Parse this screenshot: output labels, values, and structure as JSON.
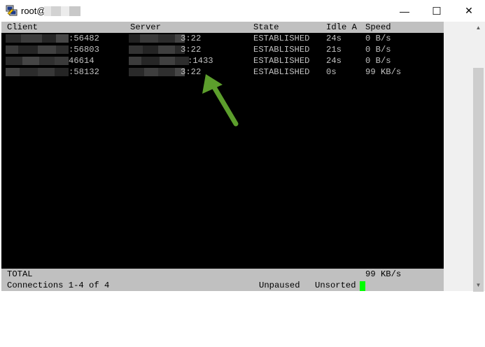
{
  "window": {
    "title": "root@",
    "minimize_glyph": "—",
    "maximize_glyph": "☐",
    "close_glyph": "✕"
  },
  "table": {
    "headers": {
      "client": "Client",
      "server": "Server",
      "state": "State",
      "idle": "Idle A",
      "speed": "Speed"
    },
    "rows": [
      {
        "client": ":56482",
        "server": "3:22",
        "state": "ESTABLISHED",
        "idle": "24s",
        "speed": "0 B/s"
      },
      {
        "client": ":56803",
        "server": "3:22",
        "state": "ESTABLISHED",
        "idle": "21s",
        "speed": "0 B/s"
      },
      {
        "client": "46614",
        "server": ":1433",
        "state": "ESTABLISHED",
        "idle": "24s",
        "speed": "0 B/s"
      },
      {
        "client": ":58132",
        "server": "3:22",
        "state": "ESTABLISHED",
        "idle": "0s",
        "speed": "99 KB/s"
      }
    ]
  },
  "footer": {
    "total_label": "TOTAL",
    "total_speed": "99 KB/s",
    "connections": "Connections 1-4 of 4",
    "paused_status": "Unpaused",
    "sort_status": "Unsorted"
  },
  "colors": {
    "terminal_bg": "#000000",
    "terminal_fg": "#c0c0c0",
    "bar_bg": "#c0c0c0",
    "cursor": "#00ff00",
    "annotation_arrow": "#5c9e2c"
  },
  "icons": {
    "app": "putty-icon",
    "annotation": "green-arrow-icon"
  }
}
